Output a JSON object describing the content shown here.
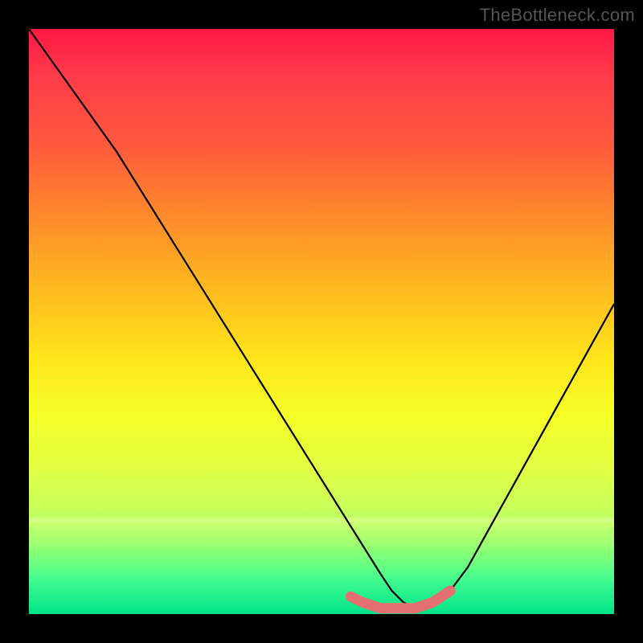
{
  "watermark": "TheBottleneck.com",
  "chart_data": {
    "type": "line",
    "title": "",
    "xlabel": "",
    "ylabel": "",
    "xlim": [
      0,
      100
    ],
    "ylim": [
      0,
      100
    ],
    "gradient_colors": {
      "top": "#ff1744",
      "mid": "#ffe41a",
      "bottom": "#00e785"
    },
    "series": [
      {
        "name": "bottleneck-curve",
        "x": [
          0,
          5,
          10,
          15,
          20,
          25,
          30,
          35,
          40,
          45,
          50,
          55,
          60,
          62,
          64,
          66,
          68,
          70,
          72,
          75,
          80,
          85,
          90,
          95,
          100
        ],
        "values": [
          100,
          93,
          86,
          79,
          71,
          63,
          55,
          47,
          39,
          31,
          23,
          15,
          7,
          4,
          2,
          1,
          1,
          2,
          4,
          8,
          17,
          26,
          35,
          44,
          53
        ]
      },
      {
        "name": "highlight-band",
        "x": [
          55,
          57,
          60,
          63,
          66,
          69,
          72
        ],
        "values": [
          3,
          2,
          1,
          1,
          1,
          2,
          4
        ]
      }
    ],
    "highlight_color": "#e47070",
    "curve_color": "#000000"
  }
}
